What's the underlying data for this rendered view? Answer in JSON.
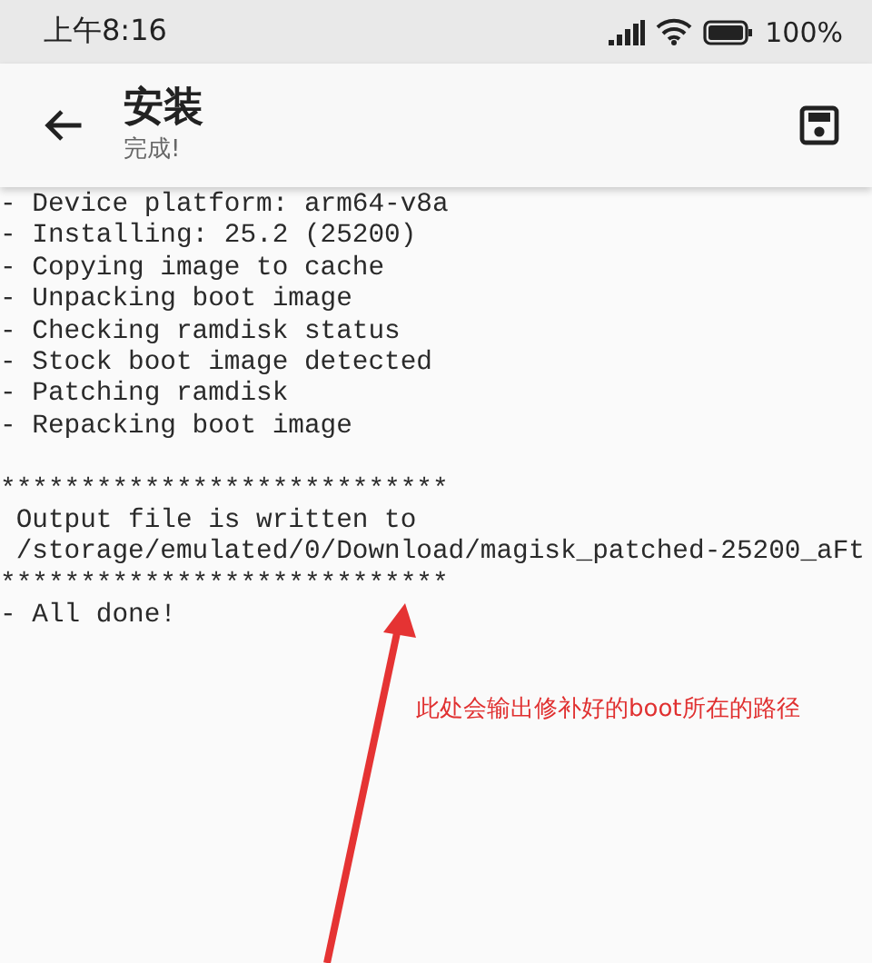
{
  "status_bar": {
    "time": "上午8:16",
    "battery": "100%"
  },
  "app_bar": {
    "title": "安装",
    "subtitle": "完成!"
  },
  "log": {
    "blocks": [
      {
        "lines": [
          "- Device platform: arm64-v8a",
          "- Installing: 25.2 (25200)",
          "- Copying image to cache",
          "- Unpacking boot image",
          "- Checking ramdisk status",
          "- Stock boot image detected",
          "- Patching ramdisk",
          "- Repacking boot image"
        ]
      },
      {
        "lines": [
          "****************************",
          " Output file is written to",
          " /storage/emulated/0/Download/magisk_patched-25200_aFt",
          "****************************",
          "- All done!"
        ]
      }
    ]
  },
  "annotation": {
    "text": "此处会输出修补好的boot所在的路径"
  }
}
